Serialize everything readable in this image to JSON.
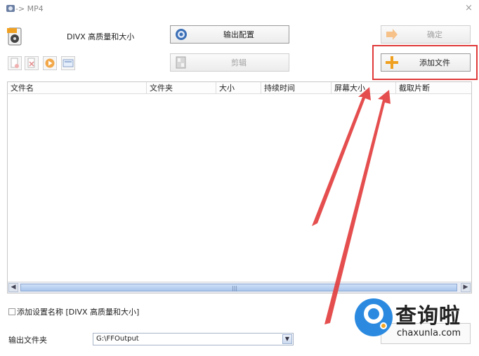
{
  "window": {
    "title": "-> MP4",
    "close": "×"
  },
  "profile": {
    "label": "DIVX 高质量和大小"
  },
  "buttons": {
    "output_config": "输出配置",
    "confirm": "确定",
    "cut": "剪辑",
    "add_file": "添加文件"
  },
  "table": {
    "columns": [
      "文件名",
      "文件夹",
      "大小",
      "持续时间",
      "屏幕大小",
      "截取片断"
    ]
  },
  "options": {
    "add_setting_name": "添加设置名称 [DIVX 高质量和大小]"
  },
  "output": {
    "label": "输出文件夹",
    "path": "G:\\FFOutput"
  },
  "watermark": {
    "cn": "查询啦",
    "en": "chaxunla.com"
  },
  "colors": {
    "highlight": "#e03a3a",
    "arrow": "#e23b3b",
    "scroll": "#a9c5ec"
  }
}
